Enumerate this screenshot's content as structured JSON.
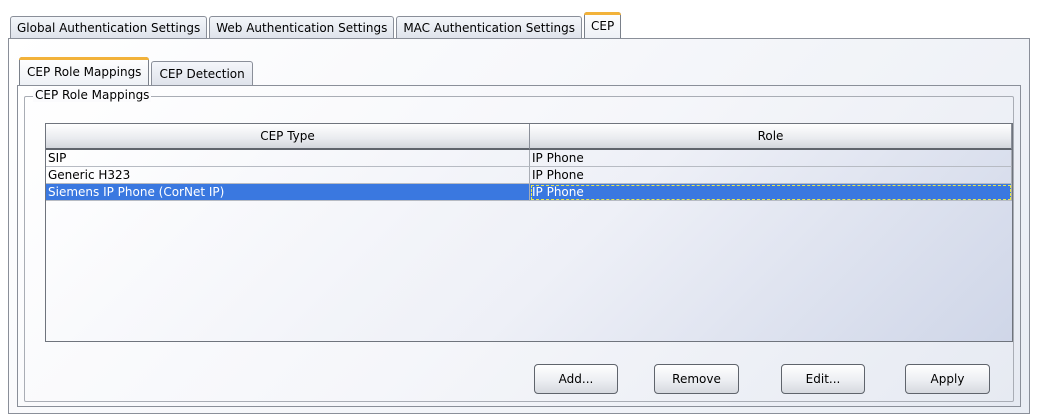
{
  "top_tabs": [
    {
      "label": "Global Authentication Settings"
    },
    {
      "label": "Web Authentication Settings"
    },
    {
      "label": "MAC Authentication Settings"
    },
    {
      "label": "CEP",
      "active": true
    }
  ],
  "sub_tabs": [
    {
      "label": "CEP Role Mappings",
      "active": true
    },
    {
      "label": "CEP Detection"
    }
  ],
  "group": {
    "legend": "CEP Role Mappings"
  },
  "table": {
    "columns": [
      "CEP Type",
      "Role"
    ],
    "rows": [
      {
        "cep_type": "SIP",
        "role": "IP Phone"
      },
      {
        "cep_type": "Generic H323",
        "role": "IP Phone"
      },
      {
        "cep_type": "Siemens IP Phone (CorNet IP)",
        "role": "IP Phone",
        "selected": true
      }
    ]
  },
  "buttons": {
    "add": "Add...",
    "remove": "Remove",
    "edit": "Edit...",
    "apply": "Apply"
  },
  "colors": {
    "selection": "#3a78e0",
    "active_tab_accent": "#f2b23a"
  }
}
